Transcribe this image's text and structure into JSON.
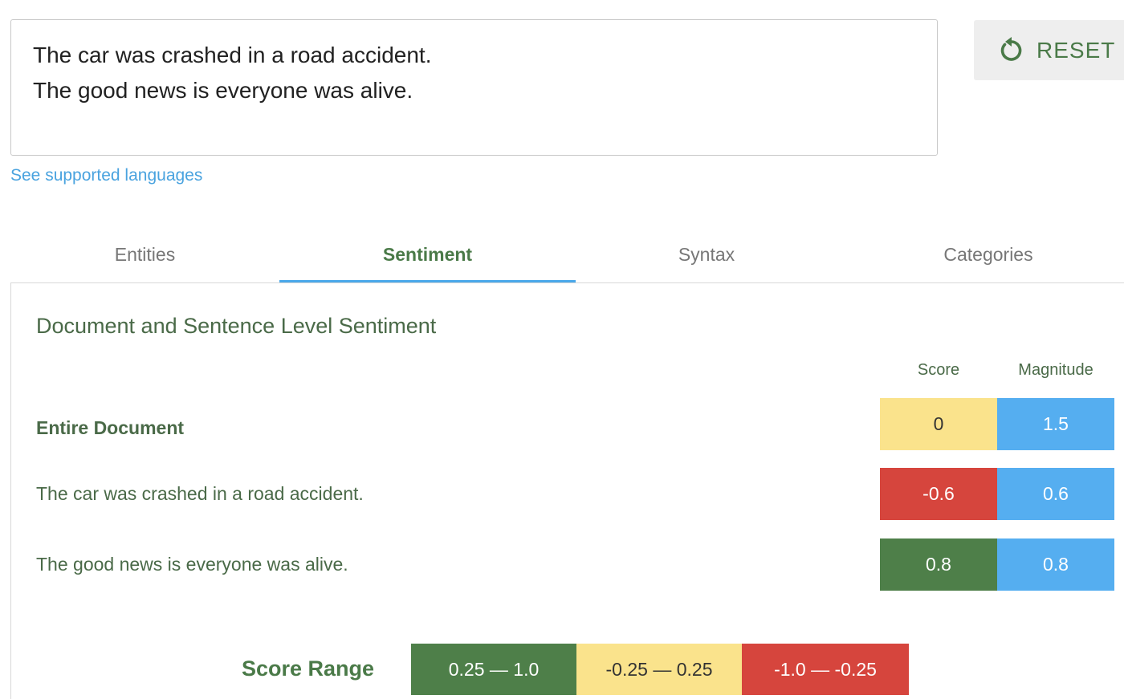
{
  "input": {
    "lines": [
      "The car was crashed in a road accident.",
      "The good news is everyone was alive."
    ]
  },
  "reset_button": {
    "label": "RESET",
    "icon": "reset-icon"
  },
  "languages_link": "See supported languages",
  "tabs": [
    {
      "label": "Entities",
      "active": false
    },
    {
      "label": "Sentiment",
      "active": true
    },
    {
      "label": "Syntax",
      "active": false
    },
    {
      "label": "Categories",
      "active": false
    }
  ],
  "sentiment": {
    "title": "Document and Sentence Level Sentiment",
    "columns": {
      "score": "Score",
      "magnitude": "Magnitude"
    },
    "rows": [
      {
        "label": "Entire Document",
        "score": "0",
        "magnitude": "1.5",
        "score_color": "#fae38c",
        "bold": true
      },
      {
        "label": "The car was crashed in a road accident.",
        "score": "-0.6",
        "magnitude": "0.6",
        "score_color": "#d6453d",
        "bold": false
      },
      {
        "label": "The good news is everyone was alive.",
        "score": "0.8",
        "magnitude": "0.8",
        "score_color": "#4e7f49",
        "bold": false
      }
    ],
    "magnitude_color": "#55aef0",
    "score_range": {
      "label": "Score Range",
      "ranges": [
        {
          "text": "0.25 — 1.0",
          "color": "#4e7f49"
        },
        {
          "text": "-0.25 — 0.25",
          "color": "#fae38c"
        },
        {
          "text": "-1.0 — -0.25",
          "color": "#d6453d"
        }
      ]
    }
  },
  "colors": {
    "accent_green": "#4a7a48",
    "link_blue": "#4aa3df",
    "tab_underline": "#4aa8ea"
  }
}
